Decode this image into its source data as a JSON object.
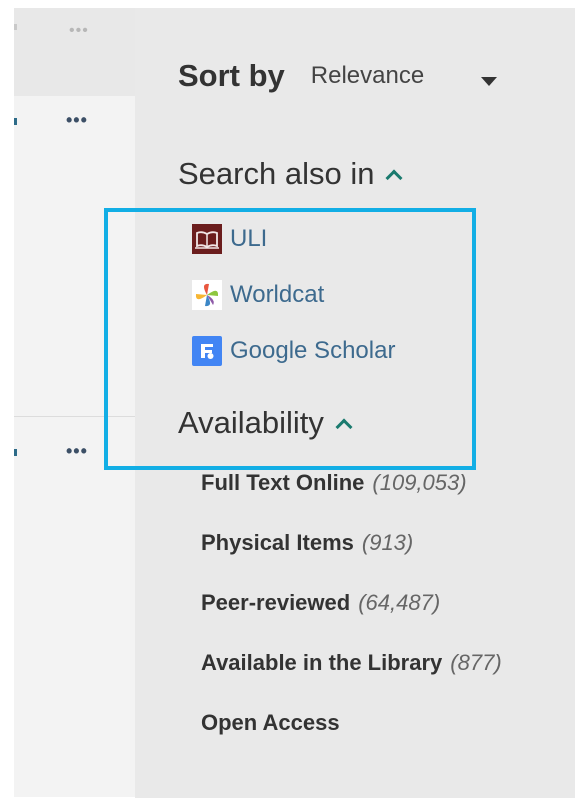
{
  "toolbar": {
    "more_icon": "more-horizontal-icon"
  },
  "results": {
    "card_more_icon": "more-horizontal-icon"
  },
  "sort": {
    "label": "Sort by",
    "value": "Relevance"
  },
  "search_also_in": {
    "title": "Search also in",
    "links": [
      {
        "label": "ULI",
        "icon": "book-logo-icon"
      },
      {
        "label": "Worldcat",
        "icon": "worldcat-logo-icon"
      },
      {
        "label": "Google Scholar",
        "icon": "google-scholar-logo-icon"
      }
    ]
  },
  "availability": {
    "title": "Availability",
    "items": [
      {
        "label": "Full Text Online",
        "count": "109,053"
      },
      {
        "label": "Physical Items",
        "count": "913"
      },
      {
        "label": "Peer-reviewed",
        "count": "64,487"
      },
      {
        "label": "Available in the Library",
        "count": "877"
      },
      {
        "label": "Open Access",
        "count": ""
      }
    ]
  },
  "colors": {
    "link": "#3d6a8e",
    "chevron": "#1a7a6e",
    "highlight": "#12aee5",
    "panel_bg": "#e9e9e9"
  }
}
